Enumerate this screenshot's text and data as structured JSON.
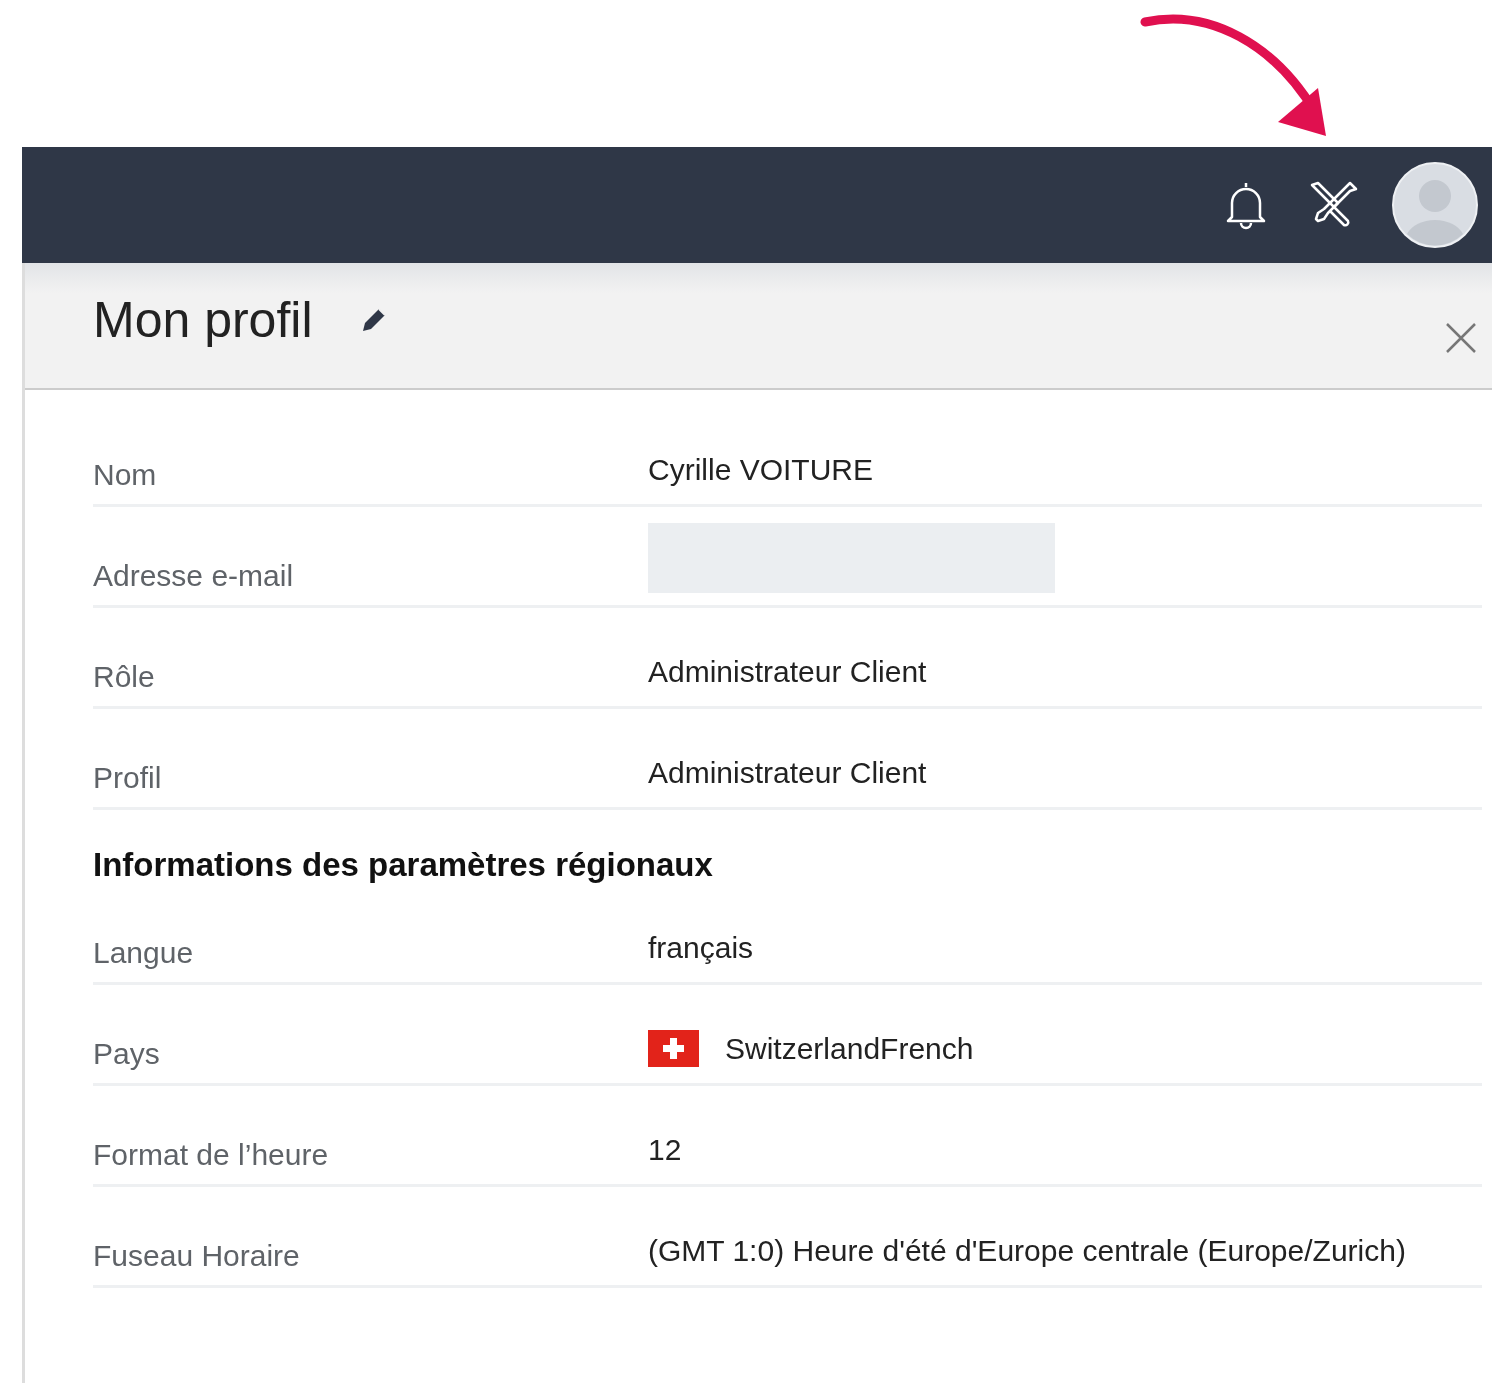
{
  "panel": {
    "title": "Mon profil"
  },
  "rows": [
    {
      "kind": "text",
      "label": "Nom",
      "value": "Cyrille VOITURE"
    },
    {
      "kind": "redacted",
      "label": "Adresse e-mail"
    },
    {
      "kind": "text",
      "label": "Rôle",
      "value": "Administrateur Client"
    },
    {
      "kind": "text",
      "label": "Profil",
      "value": "Administrateur Client"
    },
    {
      "kind": "heading",
      "label": "Informations des paramètres régionaux"
    },
    {
      "kind": "text",
      "label": "Langue",
      "value": "français"
    },
    {
      "kind": "flag",
      "label": "Pays",
      "value": "SwitzerlandFrench"
    },
    {
      "kind": "text",
      "label": "Format de l’heure",
      "value": "12"
    },
    {
      "kind": "text",
      "label": "Fuseau Horaire",
      "value": "(GMT 1:0) Heure d'été d'Europe centrale (Europe/Zurich)"
    }
  ]
}
